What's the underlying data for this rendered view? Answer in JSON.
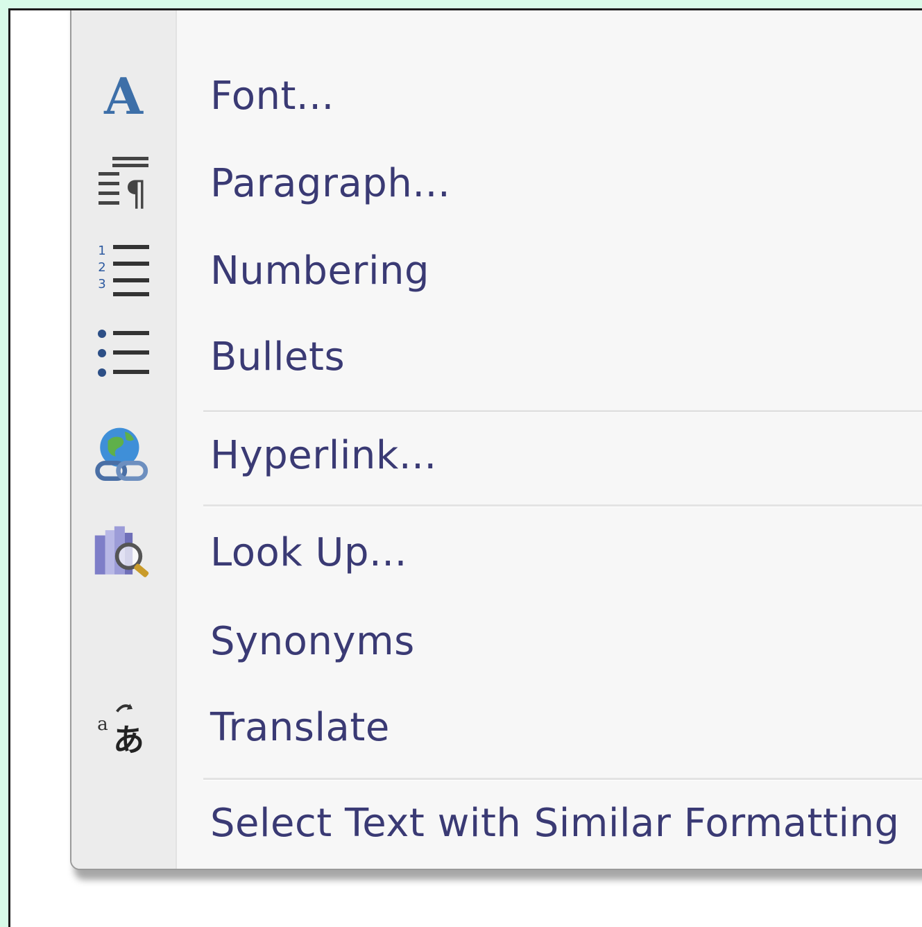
{
  "menu": {
    "items": [
      {
        "label": "Font...",
        "icon": "font-icon"
      },
      {
        "label": "Paragraph...",
        "icon": "paragraph-icon"
      },
      {
        "label": "Numbering",
        "icon": "numbering-icon"
      },
      {
        "label": "Bullets",
        "icon": "bullets-icon"
      },
      {
        "label": "Hyperlink...",
        "icon": "hyperlink-icon"
      },
      {
        "label": "Look Up...",
        "icon": "research-icon"
      },
      {
        "label": "Synonyms",
        "icon": ""
      },
      {
        "label": "Translate",
        "icon": "translate-icon"
      },
      {
        "label": "Select Text with Similar Formatting",
        "icon": ""
      }
    ]
  },
  "colors": {
    "menu_text": "#3a3a74",
    "menu_bg": "#f7f7f7",
    "gutter_bg": "#ececec",
    "page_bg": "#d8fbe9"
  }
}
